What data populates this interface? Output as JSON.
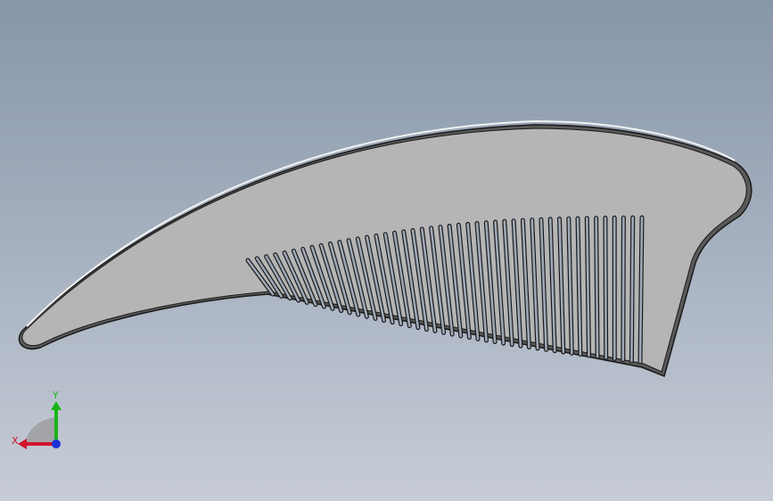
{
  "triad": {
    "x_label": "X",
    "y_label": "Y",
    "x_color": "#d0142c",
    "y_color": "#18b518",
    "z_color": "#1a2fd6"
  },
  "model": {
    "body_color": "#b5b5b5",
    "edge_color": "#1a1a1a",
    "highlight_color": "#ffffff",
    "tooth_count": 44
  }
}
